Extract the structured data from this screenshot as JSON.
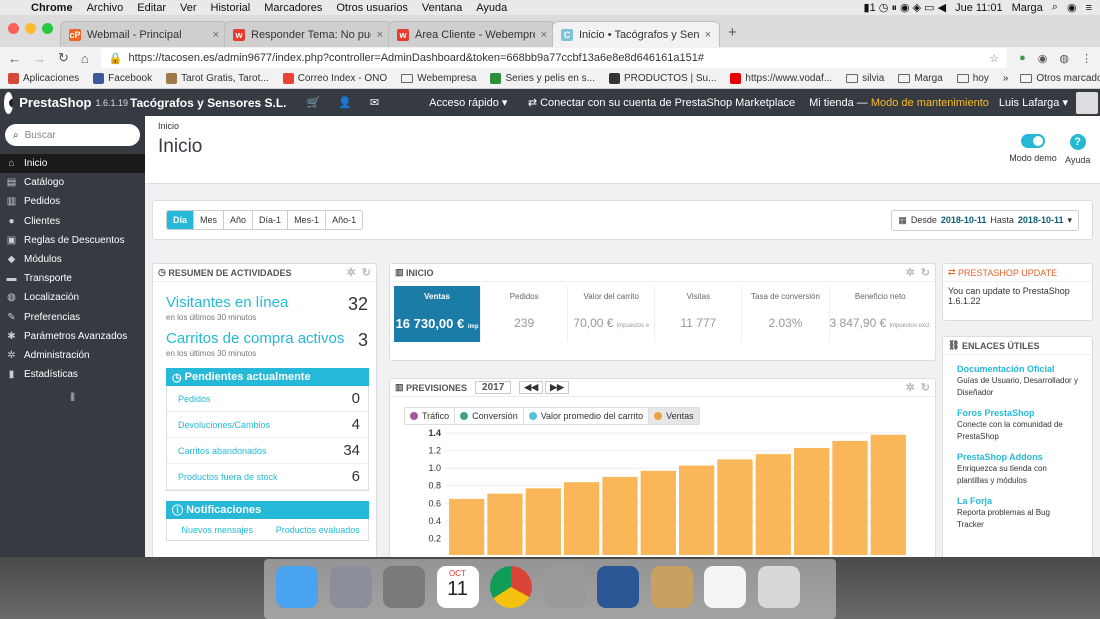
{
  "mac_menubar": {
    "app": "Chrome",
    "items": [
      "Archivo",
      "Editar",
      "Ver",
      "Historial",
      "Marcadores",
      "Otros usuarios",
      "Ventana",
      "Ayuda"
    ],
    "status_one": "1",
    "time": "Jue 11:01",
    "user": "Marga"
  },
  "browser": {
    "tabs": [
      {
        "title": "Webmail - Principal",
        "fav_color": "#f26322",
        "fav_text": "cP"
      },
      {
        "title": "Responder Tema: No puedo ac",
        "fav_color": "#e63b2e",
        "fav_text": "w"
      },
      {
        "title": "Área Cliente - Webempresa Es",
        "fav_color": "#e63b2e",
        "fav_text": "w"
      },
      {
        "title": "Inicio • Tacógrafos y Sensores",
        "fav_color": "#7bc4d8",
        "fav_text": "C"
      }
    ],
    "url": "https://tacosen.es/admin9677/index.php?controller=AdminDashboard&token=668bb9a77ccbf13a6e8e8d646161a151#",
    "bookmarks": [
      {
        "label": "Aplicaciones",
        "icon": "apps-icon",
        "color": "#d34836"
      },
      {
        "label": "Facebook",
        "icon": "facebook-icon",
        "color": "#3b5998"
      },
      {
        "label": "Tarot Gratis, Tarot...",
        "icon": "tarot-icon",
        "color": "#a0794a"
      },
      {
        "label": "Correo Index - ONO",
        "icon": "google-icon",
        "color": "#ea4335"
      },
      {
        "label": "Webempresa",
        "icon": "folder-icon",
        "color": ""
      },
      {
        "label": "Series y pelis en s...",
        "icon": "series-icon",
        "color": "#2a8f3a"
      },
      {
        "label": "PRODUCTOS | Su...",
        "icon": "productos-icon",
        "color": "#333333"
      },
      {
        "label": "https://www.vodaf...",
        "icon": "vodafone-icon",
        "color": "#e60000"
      },
      {
        "label": "silvia",
        "icon": "folder-icon",
        "color": ""
      },
      {
        "label": "Marga",
        "icon": "folder-icon",
        "color": ""
      },
      {
        "label": "hoy",
        "icon": "folder-icon",
        "color": ""
      }
    ],
    "bookmarks_more": "»",
    "other_bookmarks": "Otros marcadores"
  },
  "ps_header": {
    "logo": "PrestaShop",
    "version": "1.6.1.19",
    "shop_name": "Tacógrafos y Sensores S.L.",
    "quick_access": "Acceso rápido",
    "connect": "Conectar con su cuenta de PrestaShop Marketplace",
    "my_shop": "Mi tienda",
    "dash": "—",
    "maintenance": "Modo de mantenimiento",
    "user": "Luis Lafarga"
  },
  "sidebar": {
    "search_placeholder": "Buscar",
    "items": [
      {
        "label": "Inicio",
        "icon": "home-icon",
        "glyph": "⌂",
        "active": true
      },
      {
        "label": "Catálogo",
        "icon": "catalog-icon",
        "glyph": "▤",
        "active": false
      },
      {
        "label": "Pedidos",
        "icon": "orders-icon",
        "glyph": "▥",
        "active": false
      },
      {
        "label": "Clientes",
        "icon": "customers-icon",
        "glyph": "●",
        "active": false
      },
      {
        "label": "Reglas de Descuentos",
        "icon": "discount-icon",
        "glyph": "▣",
        "active": false
      },
      {
        "label": "Módulos",
        "icon": "modules-icon",
        "glyph": "◆",
        "active": false
      },
      {
        "label": "Transporte",
        "icon": "truck-icon",
        "glyph": "▬",
        "active": false
      },
      {
        "label": "Localización",
        "icon": "globe-icon",
        "glyph": "◍",
        "active": false
      },
      {
        "label": "Preferencias",
        "icon": "wrench-icon",
        "glyph": "✎",
        "active": false
      },
      {
        "label": "Parámetros Avanzados",
        "icon": "cogs-icon",
        "glyph": "✱",
        "active": false
      },
      {
        "label": "Administración",
        "icon": "gear-icon",
        "glyph": "✲",
        "active": false
      },
      {
        "label": "Estadísticas",
        "icon": "stats-icon",
        "glyph": "▮",
        "active": false
      }
    ],
    "collapse": "⦀"
  },
  "page": {
    "breadcrumb": "Inicio",
    "title": "Inicio",
    "demo_mode": "Modo demo",
    "help": "Ayuda"
  },
  "date_filter": {
    "periods": [
      "Día",
      "Mes",
      "Año",
      "Día-1",
      "Mes-1",
      "Año-1"
    ],
    "active_period": "Día",
    "label_from": "Desde",
    "from": "2018-10-11",
    "label_to": "Hasta",
    "to": "2018-10-11"
  },
  "activity": {
    "title": "Resumen de actividades",
    "visitors_label": "Visitantes en línea",
    "visitors_value": "32",
    "visitors_sub": "en los últimos 30 minutos",
    "carts_label": "Carritos de compra activos",
    "carts_value": "3",
    "carts_sub": "en los últimos 30 minutos",
    "pending_title": "Pendientes actualmente",
    "pending": [
      {
        "label": "Pedidos",
        "value": "0"
      },
      {
        "label": "Devoluciones/Cambios",
        "value": "4"
      },
      {
        "label": "Carritos abandonados",
        "value": "34"
      },
      {
        "label": "Productos fuera de stock",
        "value": "6"
      }
    ],
    "notif_title": "Notificaciones",
    "notif_tabs": [
      "Nuevos mensajes",
      "Productos evaluados"
    ]
  },
  "inicio": {
    "title": "Inicio",
    "kpis": [
      {
        "label": "Ventas",
        "value": "16 730,00 €",
        "suffix": "imp",
        "active": true
      },
      {
        "label": "Pedidos",
        "value": "239",
        "suffix": "",
        "active": false
      },
      {
        "label": "Valor del carrito",
        "value": "70,00 €",
        "suffix": "impuestos e",
        "active": false
      },
      {
        "label": "Visitas",
        "value": "11 777",
        "suffix": "",
        "active": false
      },
      {
        "label": "Tasa de conversión",
        "value": "2.03%",
        "suffix": "",
        "active": false
      },
      {
        "label": "Beneficio neto",
        "value": "3 847,90 €",
        "suffix": "impuestos excl.",
        "active": false
      }
    ]
  },
  "forecast": {
    "title": "Previsiones",
    "year": "2017",
    "prev": "◀◀",
    "next": "▶▶",
    "legend": [
      {
        "label": "Tráfico",
        "color": "#9e5ba1"
      },
      {
        "label": "Conversión",
        "color": "#3aa58f"
      },
      {
        "label": "Valor promedio del carrito",
        "color": "#5bc0de"
      },
      {
        "label": "Ventas",
        "color": "#f0a03c"
      }
    ]
  },
  "chart_data": {
    "type": "bar",
    "title": "",
    "categories": [
      "",
      "",
      "",
      "",
      "",
      "",
      "",
      "",
      "",
      "",
      "",
      ""
    ],
    "values": [
      0.65,
      0.71,
      0.77,
      0.84,
      0.9,
      0.97,
      1.03,
      1.1,
      1.16,
      1.23,
      1.31,
      1.38
    ],
    "series_color": "#f9b75a",
    "yticks": [
      "1.4",
      "1.2",
      "1.0",
      "0.8",
      "0.6",
      "0.4",
      "0.2"
    ],
    "ylim": [
      0,
      1.4
    ],
    "grid": true
  },
  "update": {
    "title": "PrestaShop update",
    "text": "You can update to PrestaShop 1.6.1.22"
  },
  "links": {
    "title": "Enlaces útiles",
    "items": [
      {
        "title": "Documentación Oficial",
        "desc": "Guías de Usuario, Desarrollador y Diseñador"
      },
      {
        "title": "Foros PrestaShop",
        "desc": "Conecte con la comunidad de PrestaShop"
      },
      {
        "title": "PrestaShop Addons",
        "desc": "Enriquezca su tienda con plantillas y módulos"
      },
      {
        "title": "La Forja",
        "desc": "Reporta problemas al Bug Tracker"
      }
    ]
  },
  "dock": {
    "calendar_month": "OCT",
    "calendar_day": "11",
    "apps": [
      {
        "name": "finder-icon",
        "color": "#4aa3f0"
      },
      {
        "name": "launchpad-icon",
        "color": "#8a8f99"
      },
      {
        "name": "system-prefs-icon",
        "color": "#7a7a7a"
      },
      {
        "name": "calendar-icon",
        "color": "#ffffff"
      },
      {
        "name": "chrome-icon",
        "color": "#e8e8e8"
      },
      {
        "name": "calculator-icon",
        "color": "#9a9a9a"
      },
      {
        "name": "word-icon",
        "color": "#2b5797"
      },
      {
        "name": "archive-icon",
        "color": "#c8a060"
      },
      {
        "name": "preview-icon",
        "color": "#f5f5f5"
      },
      {
        "name": "trash-icon",
        "color": "#d8d8d8"
      }
    ]
  }
}
